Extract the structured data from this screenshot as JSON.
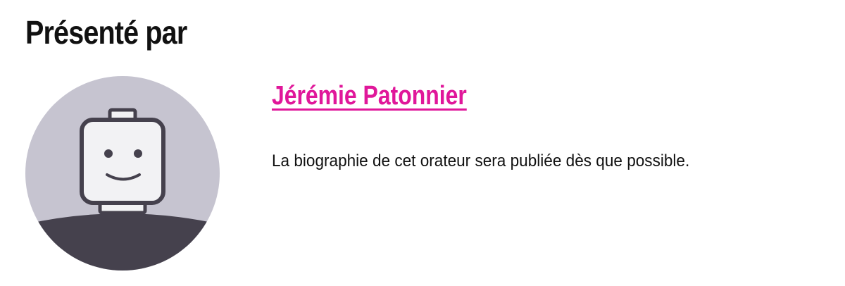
{
  "section": {
    "title": "Présenté par"
  },
  "speaker": {
    "avatar_icon": "default-avatar-icon",
    "name": "Jérémie Patonnier",
    "bio": "La biographie de cet orateur sera publiée dès que possible."
  },
  "colors": {
    "link": "#e0179a",
    "avatar_bg": "#c6c4d0",
    "avatar_body": "#45414d",
    "text": "#111111"
  }
}
